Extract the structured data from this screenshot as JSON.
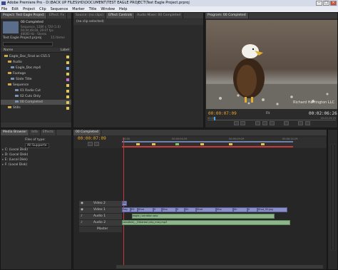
{
  "window": {
    "title": "Adobe Premiere Pro - D:\\BACK UP FILES\\HD\\DOCUMENT\\TEST EAGLE PROJECT\\Test Eagle Project.prproj"
  },
  "menu": [
    "File",
    "Edit",
    "Project",
    "Clip",
    "Sequence",
    "Marker",
    "Title",
    "Window",
    "Help"
  ],
  "project_panel": {
    "tabs": [
      "Project: Test Eagle Project",
      "Effect: Fx"
    ],
    "seq_name": "00 Completed",
    "seq_info": [
      "Sequence, 1280 x 720 (1.0)",
      "00;04;49;04, 29.97 fps",
      "48000 Hz - Stereo"
    ],
    "project_file": "Test Eagle Project.prproj",
    "item_count": "15 Items",
    "col_name": "Name",
    "col_label": "Label",
    "items": [
      {
        "label": "Eagle_Doc_Final as CS5.5",
        "kind": "folder",
        "color": "#e2c65a"
      },
      {
        "label": "Audio",
        "kind": "folder",
        "color": "#e2c65a"
      },
      {
        "label": "Eagle_Doc.mp4",
        "kind": "seq",
        "color": "#7ea0d8"
      },
      {
        "label": "Footage",
        "kind": "folder",
        "color": "#e2c65a"
      },
      {
        "label": "Slate Title",
        "kind": "seq",
        "color": "#c86ed0"
      },
      {
        "label": "Sequence",
        "kind": "folder",
        "color": "#e2c65a"
      },
      {
        "label": "01 Radio Cut",
        "kind": "seq",
        "color": "#e2c65a"
      },
      {
        "label": "02 Cuts Only",
        "kind": "seq",
        "color": "#e2c65a"
      },
      {
        "label": "00 Completed",
        "kind": "seq",
        "color": "#e2c65a"
      },
      {
        "label": "Stills",
        "kind": "folder",
        "color": "#e2c65a"
      }
    ]
  },
  "source_panel": {
    "tabs": [
      "Source: (no clips)",
      "Effect Controls",
      "Audio Mixer: 00 Completed"
    ],
    "message": "(no clip selected)"
  },
  "program_panel": {
    "tab": "Program: 00 Completed",
    "watermark": "Richard Harrington LLC",
    "timecode_in": "00:00:07:09",
    "zoom": "Fit",
    "timecode_out": "00:02:06:26",
    "ruler_left": "00:00",
    "ruler_right": "00:00:29:29"
  },
  "media_panel": {
    "tabs": [
      "Media Browser",
      "Info",
      "Effects"
    ],
    "files_of_type_label": "Files of type:",
    "files_of_type_value": "All Supporte",
    "drives": [
      "C: (Local Disk)",
      "D: (Local Disk)",
      "E: (Local Disk)",
      "F: (Local Disk)"
    ]
  },
  "timeline_panel": {
    "tab": "00 Completed",
    "timecode": "00:00:07:09",
    "ruler_labels": [
      "00:00",
      "00:00:04:29",
      "00:00:09:29",
      "00:00:14:29"
    ],
    "tracks": [
      {
        "name": "Video 2"
      },
      {
        "name": "Video 1"
      },
      {
        "name": "Audio 1"
      },
      {
        "name": "Audio 2"
      },
      {
        "name": "Master"
      }
    ],
    "v2_clip": "Ea",
    "v1_clips": [
      "Eag",
      "ES",
      "Shot",
      "S",
      "Sho",
      "S",
      "Sh",
      "Shot",
      "Sho",
      "Sh",
      "S",
      "Shot_02.jpg"
    ],
    "a1_clip": "eagle_narration.wav",
    "a2_clip": "Lensfield_-_Ethereal (clip_mix).mp3"
  }
}
